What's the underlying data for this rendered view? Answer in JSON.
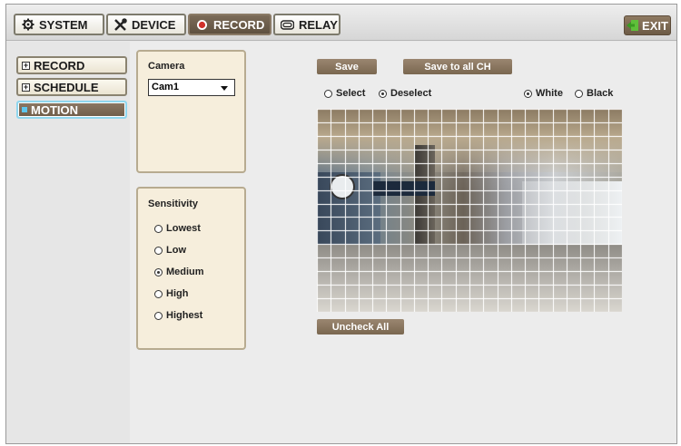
{
  "top_tabs": [
    {
      "label": "SYSTEM",
      "icon": "gear-icon"
    },
    {
      "label": "DEVICE",
      "icon": "tools-icon"
    },
    {
      "label": "RECORD",
      "icon": "record-icon"
    },
    {
      "label": "RELAY",
      "icon": "relay-icon"
    }
  ],
  "exit_label": "EXIT",
  "sidebar": {
    "items": [
      {
        "label": "RECORD"
      },
      {
        "label": "SCHEDULE"
      },
      {
        "label": "MOTION"
      }
    ]
  },
  "camera": {
    "title": "Camera",
    "selected": "Cam1"
  },
  "sensitivity": {
    "title": "Sensitivity",
    "options": [
      "Lowest",
      "Low",
      "Medium",
      "High",
      "Highest"
    ],
    "selected": "Medium"
  },
  "actions": {
    "save": "Save",
    "save_all": "Save to all CH",
    "uncheck_all": "Uncheck All"
  },
  "mode_options": {
    "select": "Select",
    "deselect": "Deselect",
    "selected": "Deselect"
  },
  "grid_color_options": {
    "white": "White",
    "black": "Black",
    "selected": "White"
  },
  "grid": {
    "columns": 22,
    "rows": 15
  },
  "colors": {
    "accent": "#7a6750",
    "panel": "#f6eedc",
    "highlight": "#5cc6ee"
  }
}
